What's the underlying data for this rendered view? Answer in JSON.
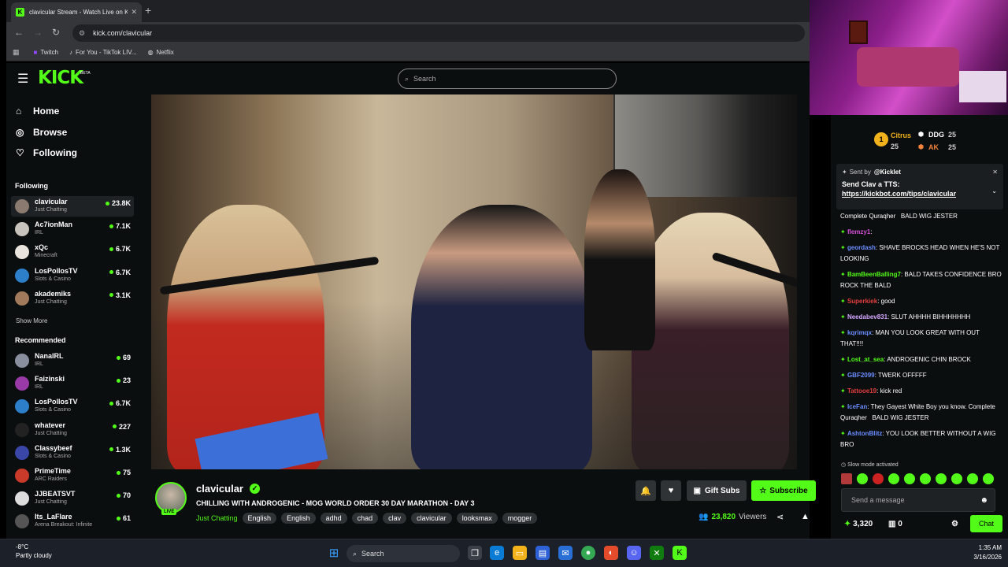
{
  "browser": {
    "tab_title": "clavicular Stream - Watch Live on Kick",
    "tab_favicon": "K",
    "url": "kick.com/clavicular",
    "bookmarks": [
      {
        "label": "Twitch",
        "icon": "twitch-icon"
      },
      {
        "label": "For You - TikTok LIV...",
        "icon": "tiktok-icon"
      },
      {
        "label": "Netflix",
        "icon": "globe-icon"
      }
    ]
  },
  "header": {
    "logo": "KICK",
    "beta": "BETA",
    "search_placeholder": "Search"
  },
  "sidebar": {
    "nav": [
      {
        "label": "Home",
        "icon": "home-icon"
      },
      {
        "label": "Browse",
        "icon": "compass-icon"
      },
      {
        "label": "Following",
        "icon": "heart-icon"
      }
    ],
    "following_label": "Following",
    "following": [
      {
        "name": "clavicular",
        "category": "Just Chatting",
        "viewers": "23.8K",
        "color": "#8a7a70"
      },
      {
        "name": "Ac7ionMan",
        "category": "IRL",
        "viewers": "7.1K",
        "color": "#c9c3bd"
      },
      {
        "name": "xQc",
        "category": "Minecraft",
        "viewers": "6.7K",
        "color": "#e9e4de"
      },
      {
        "name": "LosPollosTV",
        "category": "Slots & Casino",
        "viewers": "6.7K",
        "color": "#2d7fc9"
      },
      {
        "name": "akademiks",
        "category": "Just Chatting",
        "viewers": "3.1K",
        "color": "#a07a5a"
      }
    ],
    "show_more": "Show More",
    "recommended_label": "Recommended",
    "recommended": [
      {
        "name": "NanaIRL",
        "category": "IRL",
        "viewers": "69",
        "color": "#8a8fa0"
      },
      {
        "name": "Faizinski",
        "category": "IRL",
        "viewers": "23",
        "color": "#9a3aa8"
      },
      {
        "name": "LosPollosTV",
        "category": "Slots & Casino",
        "viewers": "6.7K",
        "color": "#2d7fc9"
      },
      {
        "name": "whatever",
        "category": "Just Chatting",
        "viewers": "227",
        "color": "#222"
      },
      {
        "name": "Classybeef",
        "category": "Slots & Casino",
        "viewers": "1.3K",
        "color": "#3a46a8"
      },
      {
        "name": "PrimeTime",
        "category": "ARC Raiders",
        "viewers": "75",
        "color": "#c93a2a"
      },
      {
        "name": "JJBEATSVT",
        "category": "Just Chatting",
        "viewers": "70",
        "color": "#ddd"
      },
      {
        "name": "Its_LaFlare",
        "category": "Arena Breakout: Infinite",
        "viewers": "61",
        "color": "#555"
      }
    ]
  },
  "stream": {
    "name": "clavicular",
    "live": "LIVE",
    "title": "CHILLING WITH ANDROGENIC - MOG WORLD ORDER 30 DAY MARATHON - DAY 3",
    "category": "Just Chatting",
    "tags": [
      "English",
      "English",
      "adhd",
      "chad",
      "clav",
      "clavicular",
      "looksmax",
      "mogger"
    ],
    "gift_label": "Gift Subs",
    "subscribe_label": "Subscribe",
    "viewers": "23,820",
    "viewers_label": "Viewers"
  },
  "chat": {
    "leaders": [
      {
        "name": "Citrus",
        "count": "25"
      },
      {
        "name": "DDG",
        "count": "25"
      },
      {
        "name": "AK",
        "count": "25"
      }
    ],
    "leader_rank": "1",
    "pinned": {
      "sent_by": "Sent by",
      "sender": "@Kicklet",
      "text": "Send Clav a TTS:",
      "link": "https://kickbot.com/tips/clavicular"
    },
    "messages": [
      {
        "user": "",
        "text": "Complete Quraqher   BALD WIG JESTER",
        "color": "#fff"
      },
      {
        "user": "flemzy1",
        "text": ":",
        "color": "#d44fd6"
      },
      {
        "user": "geordash",
        "text": ": SHAVE BROCKS HEAD WHEN HE'S NOT LOOKING",
        "color": "#6b8dff"
      },
      {
        "user": "BamBeenBalling7",
        "text": ": BALD TAKES CONFIDENCE BRO ROCK THE BALD",
        "color": "#53fc18"
      },
      {
        "user": "Superkiek",
        "text": ": good",
        "color": "#e23e3e"
      },
      {
        "user": "Needabev831",
        "text": ": SLUT AHHHH BIHHHHHHH",
        "color": "#d5a6ff"
      },
      {
        "user": "kqrimqx",
        "text": ": MAN YOU LOOK GREAT WITH OUT THAT!!!!",
        "color": "#6b8dff"
      },
      {
        "user": "Lost_at_sea",
        "text": ": ANDROGENIC CHIN BROCK",
        "color": "#53fc18"
      },
      {
        "user": "GBF2099",
        "text": ": TWERK OFFFFF",
        "color": "#6b8dff"
      },
      {
        "user": "Tattooe19",
        "text": ": kick red",
        "color": "#e23e3e"
      },
      {
        "user": "IceFan",
        "text": ": They Gayest White Boy you know. Complete Quraqher   BALD WIG JESTER",
        "color": "#6b8dff"
      },
      {
        "user": "AshtonBlitz",
        "text": ": YOU LOOK BETTER WITHOUT A WIG BRO",
        "color": "#6b8dff"
      }
    ],
    "slow_mode": "Slow mode activated",
    "send_placeholder": "Send a message",
    "points": "3,320",
    "bits": "0",
    "chat_button": "Chat"
  },
  "taskbar": {
    "temperature": "-8°C",
    "condition": "Partly cloudy",
    "search": "Search",
    "time": "1:35 AM",
    "date": "3/16/2026"
  },
  "colors": {
    "accent": "#53fc18",
    "bg": "#0b0e0f"
  }
}
